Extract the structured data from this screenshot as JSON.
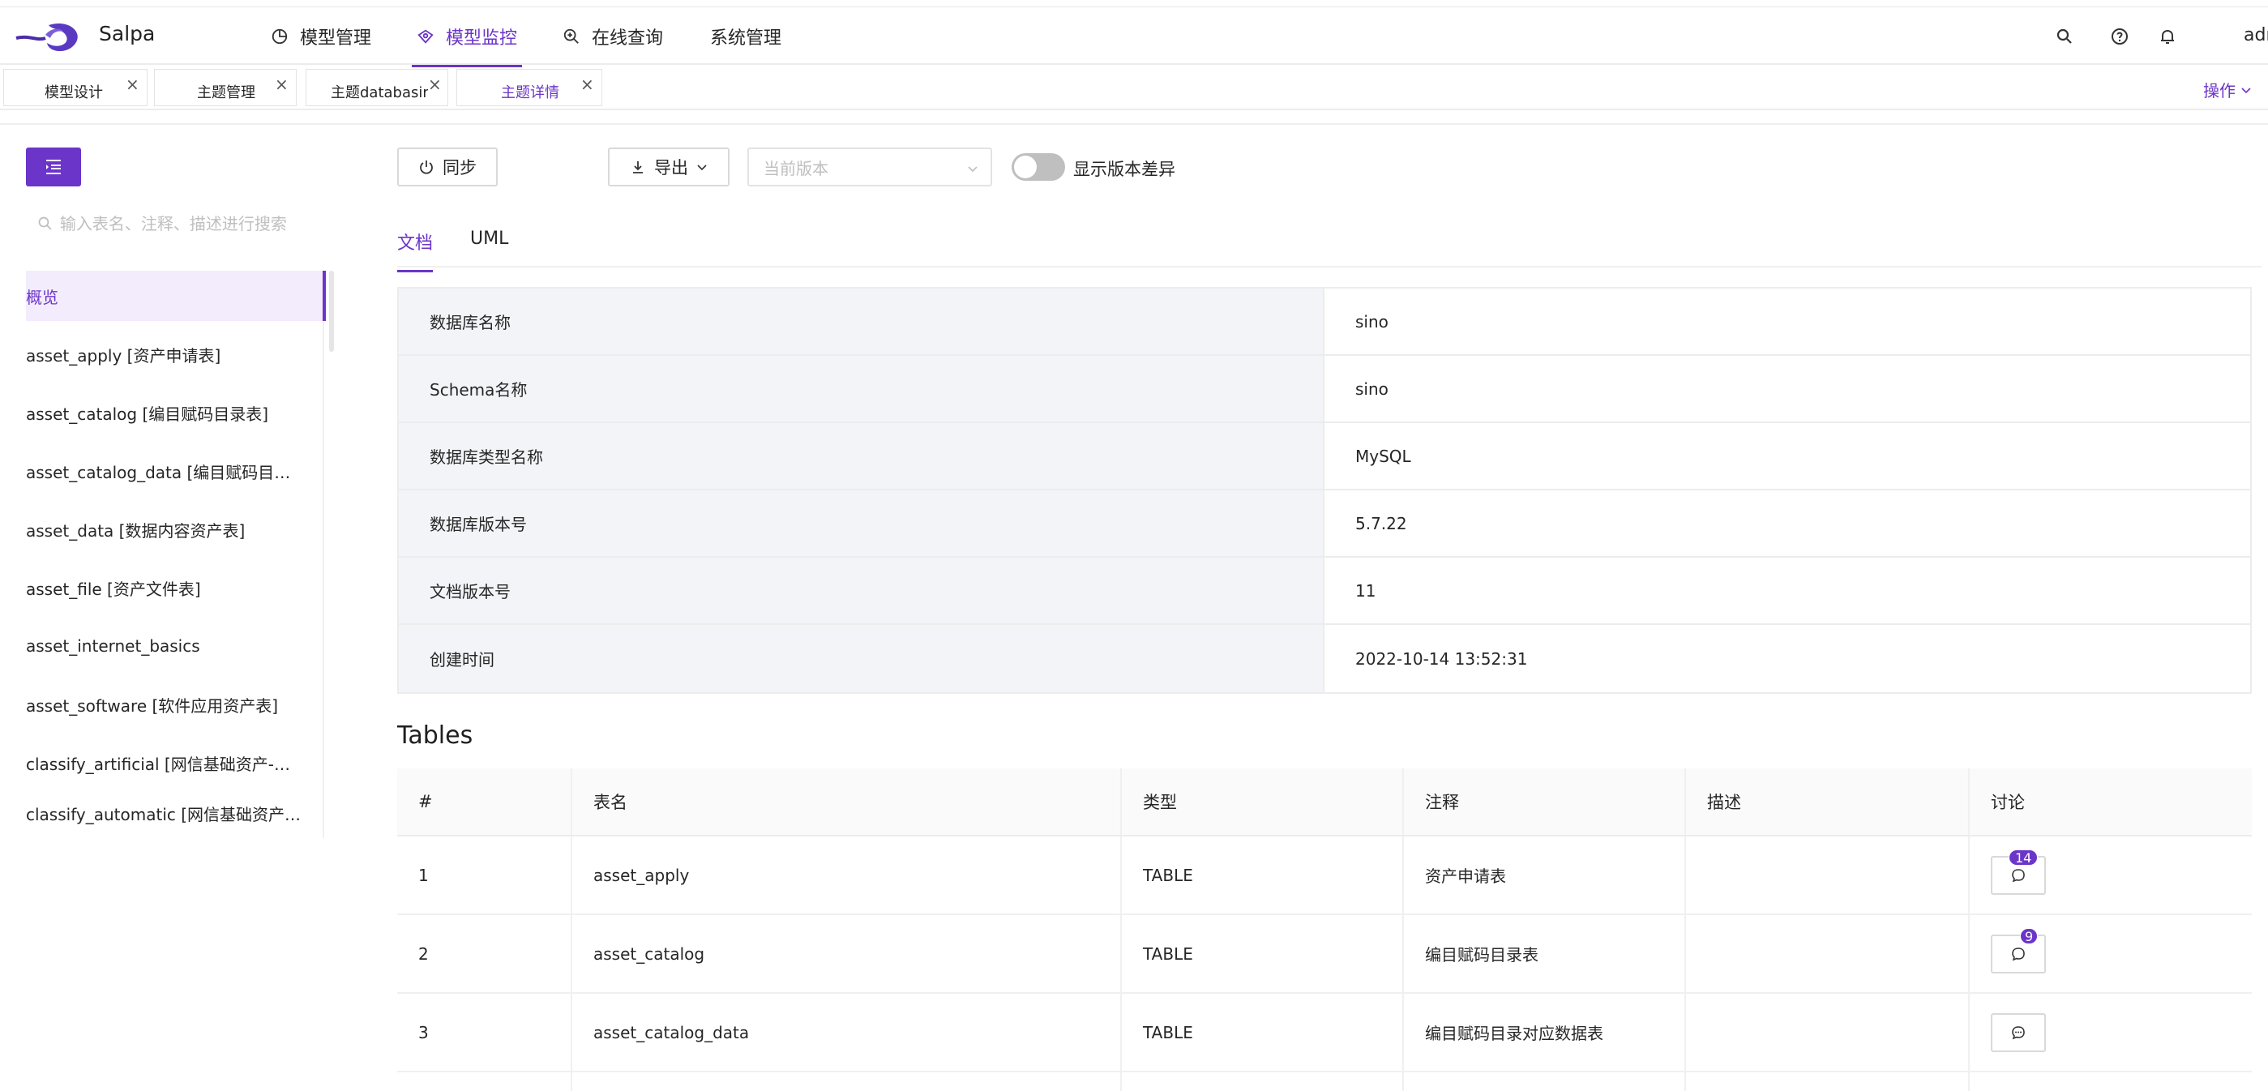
{
  "app": {
    "brand": "Salpa",
    "user": "adr"
  },
  "nav": {
    "items": [
      {
        "label": "模型管理",
        "icon": "pie-chart-icon"
      },
      {
        "label": "模型监控",
        "icon": "monitor-icon"
      },
      {
        "label": "在线查询",
        "icon": "zoom-query-icon"
      },
      {
        "label": "系统管理",
        "icon": ""
      }
    ],
    "active_index": 1
  },
  "tabs": [
    {
      "label": "模型设计",
      "close": "×"
    },
    {
      "label": "主题管理",
      "close": "×"
    },
    {
      "label": "主题databasir",
      "close": "×"
    },
    {
      "label": "主题详情",
      "close": "×"
    }
  ],
  "tabs_actions": {
    "label": "操作"
  },
  "sidebar": {
    "search_placeholder": "输入表名、注释、描述进行搜索",
    "items": [
      {
        "label": "概览"
      },
      {
        "label": "asset_apply [资产申请表]"
      },
      {
        "label": "asset_catalog [编目赋码目录表]"
      },
      {
        "label": "asset_catalog_data [编目赋码目录对应数据表]"
      },
      {
        "label": "asset_data [数据内容资产表]"
      },
      {
        "label": "asset_file [资产文件表]"
      },
      {
        "label": "asset_internet_basics"
      },
      {
        "label": "asset_software [软件应用资产表]"
      },
      {
        "label": "classify_artificial [网信基础资产-人工分类]"
      },
      {
        "label": "classify_automatic [网信基础资产-自动分类]"
      }
    ]
  },
  "toolbar": {
    "sync_label": "同步",
    "export_label": "导出",
    "version_placeholder": "当前版本",
    "diff_label": "显示版本差异"
  },
  "doc_tabs": [
    {
      "label": "文档"
    },
    {
      "label": "UML"
    }
  ],
  "info": [
    {
      "key": "数据库名称",
      "value": "sino"
    },
    {
      "key": "Schema名称",
      "value": "sino"
    },
    {
      "key": "数据库类型名称",
      "value": "MySQL"
    },
    {
      "key": "数据库版本号",
      "value": "5.7.22"
    },
    {
      "key": "文档版本号",
      "value": "11"
    },
    {
      "key": "创建时间",
      "value": "2022-10-14 13:52:31"
    }
  ],
  "tables_section": {
    "title": "Tables",
    "columns": [
      "#",
      "表名",
      "类型",
      "注释",
      "描述",
      "讨论"
    ],
    "rows": [
      {
        "index": "1",
        "name": "asset_apply",
        "type": "TABLE",
        "comment": "资产申请表",
        "desc": "",
        "discuss_count": "14"
      },
      {
        "index": "2",
        "name": "asset_catalog",
        "type": "TABLE",
        "comment": "编目赋码目录表",
        "desc": "",
        "discuss_count": "9"
      },
      {
        "index": "3",
        "name": "asset_catalog_data",
        "type": "TABLE",
        "comment": "编目赋码目录对应数据表",
        "desc": "",
        "discuss_count": ""
      }
    ]
  },
  "colors": {
    "accent": "#6b35c9",
    "key_bg": "#f3f4f8",
    "border": "#ececec"
  }
}
